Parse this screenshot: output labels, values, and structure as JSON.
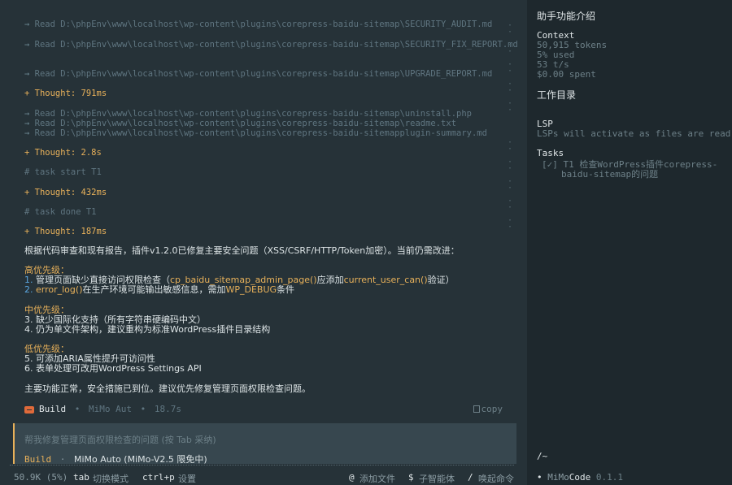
{
  "log": {
    "reads_a": [
      "Read D:\\phpEnv\\www\\localhost\\wp-content\\plugins\\corepress-baidu-sitemap\\SECURITY_AUDIT.md",
      "Read D:\\phpEnv\\www\\localhost\\wp-content\\plugins\\corepress-baidu-sitemap\\SECURITY_FIX_REPORT.md",
      "Read D:\\phpEnv\\www\\localhost\\wp-content\\plugins\\corepress-baidu-sitemap\\UPGRADE_REPORT.md"
    ],
    "thought1": "+ Thought: 791ms",
    "reads_b": [
      "Read D:\\phpEnv\\www\\localhost\\wp-content\\plugins\\corepress-baidu-sitemap\\uninstall.php",
      "Read D:\\phpEnv\\www\\localhost\\wp-content\\plugins\\corepress-baidu-sitemap\\readme.txt",
      "Read D:\\phpEnv\\www\\localhost\\wp-content\\plugins\\corepress-baidu-sitemapplugin-summary.md"
    ],
    "arrow": "→",
    "thought2": "+ Thought: 2.8s",
    "task_start": "# task start T1",
    "thought3": "+ Thought: 432ms",
    "task_done": "# task done T1",
    "thought4": "+ Thought: 187ms"
  },
  "answer": {
    "intro": "根据代码审查和现有报告，插件v1.2.0已修复主要安全问题（XSS/CSRF/HTTP/Token加密）。当前仍需改进：",
    "high_label": "高优先级：",
    "high_1_num": "1.",
    "high_1_a": "管理页面缺少直接访问权限检查（",
    "high_1_code1": "cp_baidu_sitemap_admin_page()",
    "high_1_b": "应添加",
    "high_1_code2": "current_user_can()",
    "high_1_c": "验证）",
    "high_2_num": "2.",
    "high_2_code1": "error_log()",
    "high_2_a": "在生产环境可能输出敏感信息，需加",
    "high_2_code2": "WP_DEBUG",
    "high_2_b": "条件",
    "mid_label": "中优先级：",
    "mid_1": "3. 缺少国际化支持（所有字符串硬编码中文）",
    "mid_2": "4. 仍为单文件架构，建议重构为标准WordPress插件目录结构",
    "low_label": "低优先级：",
    "low_1": "5. 可添加ARIA属性提升可访问性",
    "low_2": "6. 表单处理可改用WordPress Settings API",
    "summary": "主要功能正常，安全措施已到位。建议优先修复管理页面权限检查问题。"
  },
  "status": {
    "mode": "Build",
    "sep": "•",
    "model": "MiMo Aut",
    "time": "18.7s",
    "copy": "copy"
  },
  "input": {
    "placeholder": "帮我修复管理页面权限检查的问题 (按 Tab 采纳)",
    "mode": "Build",
    "sep": "·",
    "model": "MiMo Auto (MiMo-V2.5 限免中)"
  },
  "bottom": {
    "tokens": "50.9K (5%)",
    "tab_key": "tab",
    "tab_label": "切换模式",
    "ctrlp_key": "ctrl+p",
    "ctrlp_label": "设置",
    "at_key": "@",
    "at_label": "添加文件",
    "dollar_key": "$",
    "dollar_label": "子智能体",
    "slash_key": "/",
    "slash_label": "唤起命令"
  },
  "sidebar": {
    "title": "助手功能介绍",
    "context_head": "Context",
    "context_tokens": "50,915 tokens",
    "context_used": "5% used",
    "context_speed": "53 t/s",
    "context_spent": "$0.00 spent",
    "workdir_head": "工作目录",
    "lsp_head": "LSP",
    "lsp_desc": "LSPs will activate as files are read",
    "tasks_head": "Tasks",
    "task_check": "[✓]",
    "task_1a": "T1 检查WordPress插件corepress-",
    "task_1b": "baidu-sitemap的问题",
    "path": "/~",
    "brand_dot": "•",
    "brand_a": "MiMo",
    "brand_b": "Code",
    "version": "0.1.1"
  },
  "colors": {
    "background": "#263238",
    "sidebar": "#1e282d",
    "accent": "#e8b15a",
    "blue": "#5aa6e0",
    "build": "#e06a3a"
  }
}
